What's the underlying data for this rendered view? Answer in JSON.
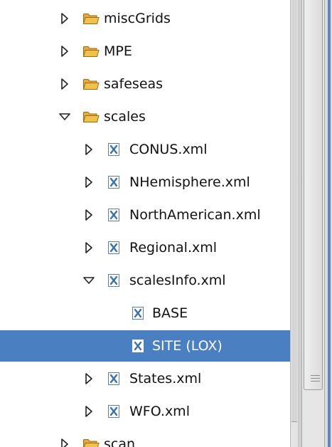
{
  "tree": {
    "items": [
      {
        "label": "miscGrids",
        "type": "folder",
        "expanded": false,
        "depth": 0
      },
      {
        "label": "MPE",
        "type": "folder",
        "expanded": false,
        "depth": 0
      },
      {
        "label": "safeseas",
        "type": "folder",
        "expanded": false,
        "depth": 0
      },
      {
        "label": "scales",
        "type": "folder",
        "expanded": true,
        "depth": 0
      },
      {
        "label": "CONUS.xml",
        "type": "xml-file",
        "expanded": false,
        "depth": 1
      },
      {
        "label": "NHemisphere.xml",
        "type": "xml-file",
        "expanded": false,
        "depth": 1
      },
      {
        "label": "NorthAmerican.xml",
        "type": "xml-file",
        "expanded": false,
        "depth": 1
      },
      {
        "label": "Regional.xml",
        "type": "xml-file",
        "expanded": false,
        "depth": 1
      },
      {
        "label": "scalesInfo.xml",
        "type": "xml-file",
        "expanded": true,
        "depth": 1
      },
      {
        "label": "BASE",
        "type": "xml-level",
        "depth": 2,
        "leaf": true
      },
      {
        "label": "SITE (LOX)",
        "type": "xml-level",
        "depth": 2,
        "leaf": true,
        "selected": true
      },
      {
        "label": "States.xml",
        "type": "xml-file",
        "expanded": false,
        "depth": 1
      },
      {
        "label": "WFO.xml",
        "type": "xml-file",
        "expanded": false,
        "depth": 1
      },
      {
        "label": "scan",
        "type": "folder",
        "expanded": false,
        "depth": 0
      }
    ]
  },
  "colors": {
    "selection": "#4a7fc1",
    "folder": "#f0c24a",
    "xml_icon": "#3a6fb8"
  },
  "icons": {
    "folder": "folder-icon",
    "xml_file": "xml-file-icon",
    "expand": "expand-arrow-icon",
    "collapse": "collapse-arrow-icon"
  }
}
